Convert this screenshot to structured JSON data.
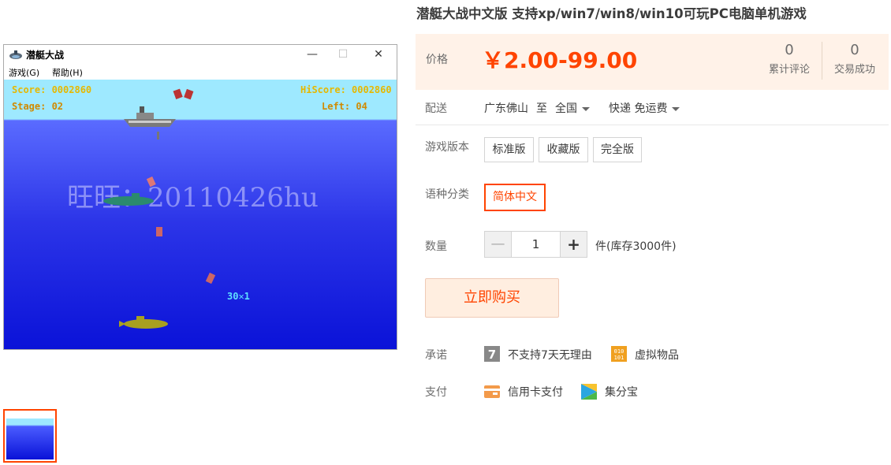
{
  "game_window": {
    "title": "潜艇大战",
    "controls": {
      "minimize": "—",
      "maximize": "☐",
      "close": "✕"
    },
    "menu": [
      "游戏(G)",
      "帮助(H)"
    ],
    "hud": {
      "score": "Score: 0002860",
      "hiscore": "HiScore: 0002860",
      "stage": "Stage: 02",
      "left": "Left: 04"
    },
    "watermark": "旺旺：20110426hu",
    "combo": "30✕1"
  },
  "product": {
    "title": "潜艇大战中文版 支持xp/win7/win8/win10可玩PC电脑单机游戏",
    "price_label": "价格",
    "price": "￥2.00-99.00",
    "stats": [
      {
        "num": "0",
        "text": "累计评论"
      },
      {
        "num": "0",
        "text": "交易成功"
      }
    ],
    "shipping": {
      "label": "配送",
      "from": "广东佛山",
      "to_word": "至",
      "to": "全国",
      "method": "快递 免运费"
    },
    "edition": {
      "label": "游戏版本",
      "options": [
        "标准版",
        "收藏版",
        "完全版"
      ]
    },
    "language": {
      "label": "语种分类",
      "options": [
        "简体中文"
      ]
    },
    "quantity": {
      "label": "数量",
      "minus": "—",
      "value": "1",
      "plus": "+",
      "stock": "件(库存3000件)"
    },
    "buy_label": "立即购买",
    "promise": {
      "label": "承诺",
      "items": [
        "不支持7天无理由",
        "虚拟物品"
      ]
    },
    "payment": {
      "label": "支付",
      "items": [
        "信用卡支付",
        "集分宝"
      ]
    }
  },
  "colors": {
    "accent": "#ff4400",
    "price_bg": "#fff2e8"
  }
}
